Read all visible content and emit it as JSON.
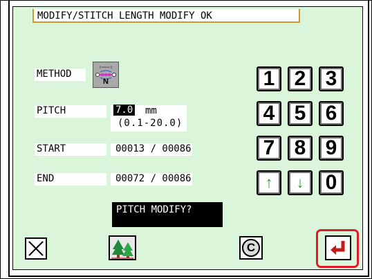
{
  "title": "MODIFY/STITCH LENGTH MODIFY  OK",
  "method": {
    "label": "METHOD",
    "icon": "needle-mode-icon",
    "icon_letter": "N"
  },
  "pitch": {
    "label": "PITCH",
    "value": "7.0",
    "unit": "mm",
    "range": "(0.1-20.0)"
  },
  "start": {
    "label": "START",
    "value": "00013 / 00086"
  },
  "end": {
    "label": "END",
    "value": "00072 / 00086"
  },
  "keypad": {
    "k1": "1",
    "k2": "2",
    "k3": "3",
    "k4": "4",
    "k5": "5",
    "k6": "6",
    "k7": "7",
    "k8": "8",
    "k9": "9",
    "up": "↑",
    "down": "↓",
    "k0": "0"
  },
  "message": "PITCH MODIFY?",
  "bottom": {
    "cancel": "close-icon",
    "tree": "tree-icon",
    "clear": "C",
    "enter": "enter-icon"
  },
  "colors": {
    "screen_bg": "#dbf5db",
    "accent_red": "#e0192b",
    "arrow_green": "#2b9a2b",
    "title_border": "#cc9933"
  }
}
